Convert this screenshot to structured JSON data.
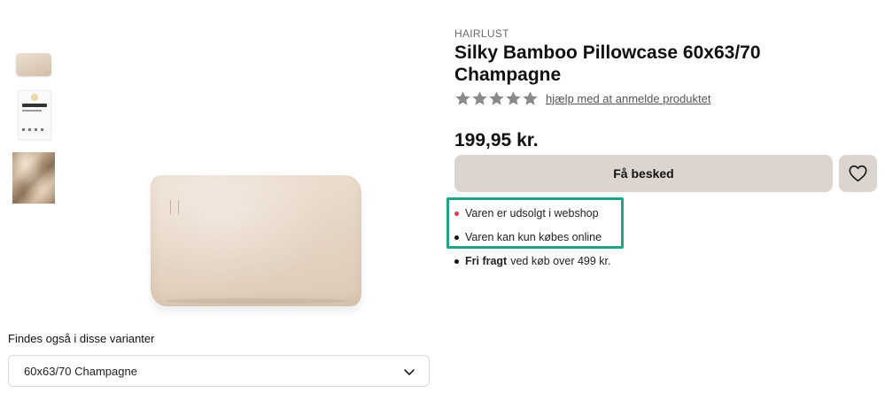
{
  "gallery": {
    "thumbnails": [
      {
        "icon": "pillowcase-thumbnail"
      },
      {
        "icon": "package-thumbnail"
      },
      {
        "icon": "silk-fabric-thumbnail"
      }
    ],
    "main_image_icon": "pillowcase-main-image"
  },
  "variants": {
    "label": "Findes også i disse varianter",
    "selected": "60x63/70 Champagne"
  },
  "product": {
    "brand": "HAIRLUST",
    "title": "Silky Bamboo Pillowcase 60x63/70 Champagne",
    "rating": 0,
    "rating_max": 5,
    "review_link": "hjælp med at anmelde produktet",
    "price": "199,95 kr."
  },
  "actions": {
    "notify_label": "Få besked",
    "wishlist_icon": "heart-icon"
  },
  "info": {
    "stock_status": "Varen er udsolgt i webshop",
    "online_only": "Varen kan kun købes online",
    "shipping_bold": "Fri fragt",
    "shipping_rest": "ved køb over 499 kr."
  },
  "colors": {
    "button_bg": "#dcd5cf",
    "highlight_border": "#22a386",
    "status_red": "#e0394b",
    "star_gray": "#8a8a8a"
  }
}
